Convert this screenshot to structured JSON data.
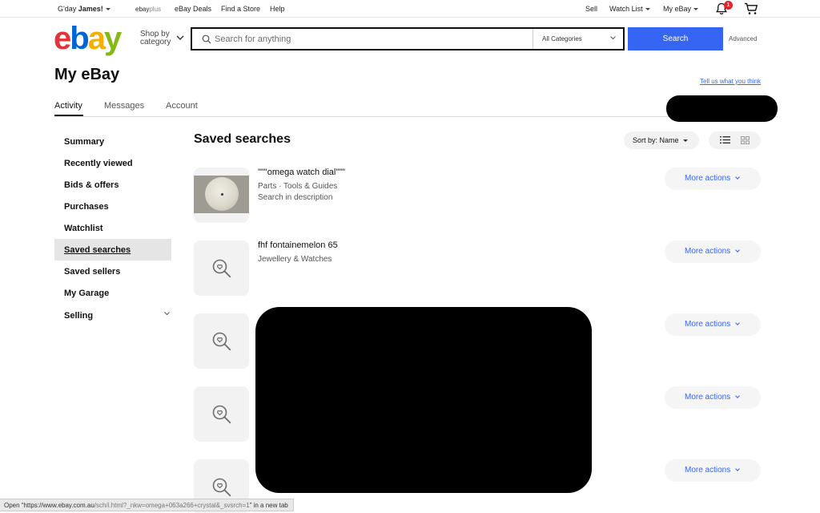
{
  "topbar": {
    "greeting_prefix": "G'day",
    "user_name": "James!",
    "ebayplus_a": "ebay",
    "ebayplus_b": "plus",
    "deals": "eBay Deals",
    "find_store": "Find a Store",
    "help": "Help",
    "sell": "Sell",
    "watch_list": "Watch List",
    "my_ebay": "My eBay",
    "notification_count": "1"
  },
  "header": {
    "logo": {
      "e": "e",
      "b": "b",
      "a": "a",
      "y": "y"
    },
    "shop_by_line1": "Shop by",
    "shop_by_line2": "category",
    "search_placeholder": "Search for anything",
    "search_value": "",
    "category_selected": "All Categories",
    "search_button": "Search",
    "advanced": "Advanced"
  },
  "page": {
    "title": "My eBay",
    "feedback_link": "Tell us what you think",
    "tabs": [
      {
        "label": "Activity",
        "active": true
      },
      {
        "label": "Messages",
        "active": false
      },
      {
        "label": "Account",
        "active": false
      }
    ]
  },
  "sidebar": {
    "items": [
      {
        "label": "Summary"
      },
      {
        "label": "Recently viewed"
      },
      {
        "label": "Bids & offers"
      },
      {
        "label": "Purchases"
      },
      {
        "label": "Watchlist"
      },
      {
        "label": "Saved searches",
        "active": true
      },
      {
        "label": "Saved sellers"
      },
      {
        "label": "My Garage"
      },
      {
        "label": "Selling"
      }
    ]
  },
  "main": {
    "title": "Saved searches",
    "sort_label": "Sort by: Name",
    "more_actions": "More actions",
    "searches": [
      {
        "title": "\"\"\"omega watch dial\"\"\"",
        "category": "Parts · Tools & Guides",
        "note": "Search in description",
        "thumb": "watch-dial-photo"
      },
      {
        "title": "fhf fontainemelon 65",
        "category": "Jewellery & Watches",
        "thumb": "saved-search-icon"
      },
      {
        "title": "",
        "thumb": "saved-search-icon"
      },
      {
        "title": "",
        "thumb": "saved-search-icon"
      },
      {
        "title": "",
        "thumb": "saved-search-icon"
      }
    ]
  },
  "status_bar": {
    "text_prefix": "Open “https://www.ebay.com.au",
    "text_path": "/sch/i.html?_nkw=omega+063a266+crystal&_svsrch=1",
    "text_suffix": "” in a new tab"
  },
  "colors": {
    "accent": "#3665f3",
    "logo_e": "#e53238",
    "logo_b": "#0064d2",
    "logo_a": "#f5af02",
    "logo_y": "#86b817",
    "notification": "#e0242e"
  }
}
